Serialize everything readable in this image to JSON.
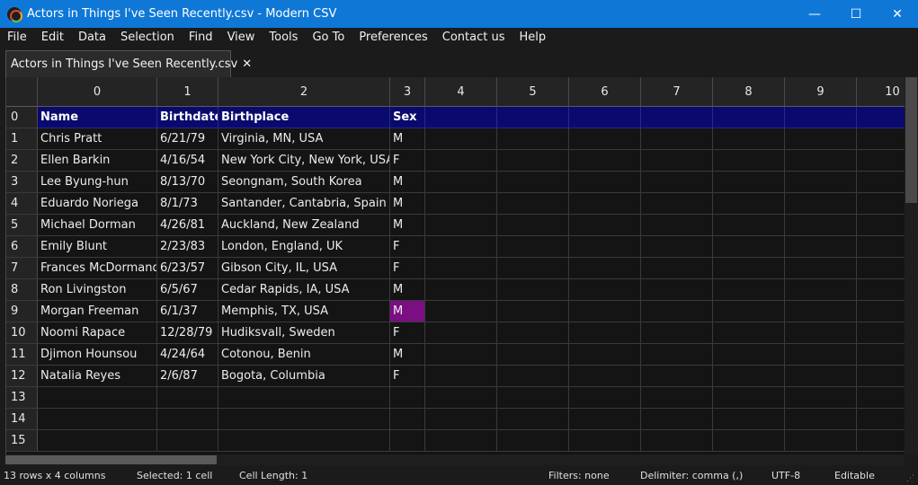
{
  "window": {
    "title": "Actors in Things I've Seen Recently.csv - Modern CSV",
    "minimize_glyph": "—",
    "maximize_glyph": "☐",
    "close_glyph": "✕"
  },
  "menu": [
    "File",
    "Edit",
    "Data",
    "Selection",
    "Find",
    "View",
    "Tools",
    "Go To",
    "Preferences",
    "Contact us",
    "Help"
  ],
  "tab": {
    "label": "Actors in Things I've Seen Recently.csv",
    "close_glyph": "✕"
  },
  "grid": {
    "column_headers": [
      "0",
      "1",
      "2",
      "3",
      "4",
      "5",
      "6",
      "7",
      "8",
      "9",
      "10"
    ],
    "row_headers": [
      "0",
      "1",
      "2",
      "3",
      "4",
      "5",
      "6",
      "7",
      "8",
      "9",
      "10",
      "11",
      "12",
      "13",
      "14",
      "15"
    ],
    "rows": [
      [
        "Name",
        "Birthdate",
        "Birthplace",
        "Sex"
      ],
      [
        "Chris Pratt",
        "6/21/79",
        "Virginia, MN, USA",
        "M"
      ],
      [
        "Ellen Barkin",
        "4/16/54",
        "New York City, New York, USA",
        "F"
      ],
      [
        "Lee Byung-hun",
        "8/13/70",
        "Seongnam, South Korea",
        "M"
      ],
      [
        "Eduardo Noriega",
        "8/1/73",
        "Santander, Cantabria, Spain",
        "M"
      ],
      [
        "Michael Dorman",
        "4/26/81",
        "Auckland, New Zealand",
        "M"
      ],
      [
        "Emily Blunt",
        "2/23/83",
        "London, England, UK",
        "F"
      ],
      [
        "Frances McDormand",
        "6/23/57",
        "Gibson City, IL, USA",
        "F"
      ],
      [
        "Ron Livingston",
        "6/5/67",
        "Cedar Rapids, IA, USA",
        "M"
      ],
      [
        "Morgan Freeman",
        "6/1/37",
        "Memphis, TX, USA",
        "M"
      ],
      [
        "Noomi Rapace",
        "12/28/79",
        "Hudiksvall, Sweden",
        "F"
      ],
      [
        "Djimon Hounsou",
        "4/24/64",
        "Cotonou, Benin",
        "M"
      ],
      [
        "Natalia Reyes",
        "2/6/87",
        "Bogota, Columbia",
        "F"
      ]
    ],
    "selected_cell": {
      "row": 9,
      "col": 3
    },
    "colors": {
      "header_row": "#0a0a6e",
      "selected": "#7a0e82",
      "titlebar": "#0f78d7"
    }
  },
  "status": {
    "dimensions": "13 rows x 4 columns",
    "selected": "Selected: 1 cell",
    "cell_length": "Cell Length: 1",
    "filters": "Filters: none",
    "delimiter": "Delimiter: comma (,)",
    "encoding": "UTF-8",
    "mode": "Editable"
  }
}
